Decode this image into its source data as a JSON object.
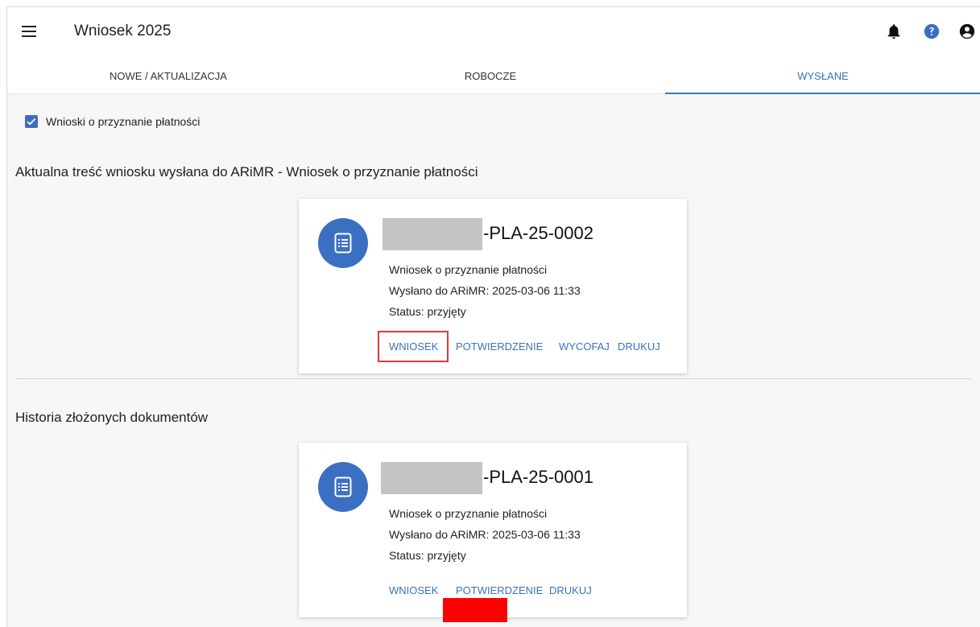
{
  "app": {
    "title": "Wniosek 2025"
  },
  "tabs": [
    {
      "label": "NOWE / AKTUALIZACJA"
    },
    {
      "label": "ROBOCZE"
    },
    {
      "label": "WYSŁANE"
    }
  ],
  "filter": {
    "checkbox_label": "Wnioski o przyznanie płatności",
    "checked": true
  },
  "current": {
    "heading": "Aktualna treść wniosku wysłana do ARiMR - Wniosek o przyznanie płatności",
    "card": {
      "doc_number": "-PLA-25-0002",
      "type": "Wniosek o przyznanie płatności",
      "sent": "Wysłano do ARiMR: 2025-03-06 11:33",
      "status": "Status: przyjęty",
      "actions": [
        "WNIOSEK",
        "POTWIERDZENIE",
        "WYCOFAJ",
        "DRUKUJ"
      ]
    }
  },
  "history": {
    "heading": "Historia złożonych dokumentów",
    "card": {
      "doc_number": "-PLA-25-0001",
      "type": "Wniosek o przyznanie płatności",
      "sent": "Wysłano do ARiMR: 2025-03-06 11:33",
      "status": "Status: przyjęty",
      "actions": [
        "WNIOSEK",
        "POTWIERDZENIE",
        "DRUKUJ"
      ]
    }
  },
  "colors": {
    "accent": "#3b73b9",
    "highlight": "#e0393a",
    "icon_bg": "#3b6fc1"
  },
  "icons": {
    "menu": "menu-icon",
    "bell": "bell-icon",
    "help": "help-icon",
    "account": "account-icon",
    "document": "document-icon"
  }
}
